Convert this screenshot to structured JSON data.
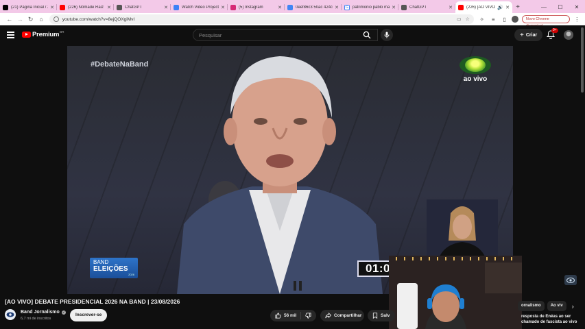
{
  "browser": {
    "tabs": [
      {
        "title": "(21) Página Inicial / X",
        "fav_color": "#000000"
      },
      {
        "title": "(226) Nômade Raiz -",
        "fav_color": "#ff0000"
      },
      {
        "title": "ChatGPT",
        "fav_color": "#555555"
      },
      {
        "title": "Watch Video Project -",
        "fav_color": "#3b82f6"
      },
      {
        "title": "(5) Instagram",
        "fav_color": "#d62976"
      },
      {
        "title": "0eef86c3 50ac 424c 8",
        "fav_color": "#4285f4"
      },
      {
        "title": "patrimonio pablo mar",
        "fav_color": "#4285f4"
      },
      {
        "title": "ChatGPT",
        "fav_color": "#555555"
      },
      {
        "title": "(226) [AO VIVO] D",
        "fav_color": "#ff0000",
        "active": true
      }
    ],
    "new_tab_label": "+",
    "url": "youtube.com/watch?v=8ejQOXgiMvI",
    "chrome_pill": "Novo Chrome disponível"
  },
  "youtube": {
    "logo_text": "Premium",
    "logo_country": "BR",
    "search_placeholder": "Pesquisar",
    "create_label": "Criar",
    "notif_count": "9+"
  },
  "video": {
    "hashtag": "#DebateNaBand",
    "live_label": "ao vivo",
    "eleicoes_line1": "BAND",
    "eleicoes_line2": "ELEIÇÕES",
    "eleicoes_year": "2026",
    "timer": "01:0",
    "title": "[AO VIVO] DEBATE PRESIDENCIAL 2026 NA BAND | 23/08/2026",
    "channel": "Band Jornalismo",
    "subscribers": "6,7 mi de inscritos",
    "subscribe_label": "Inscrever-se",
    "likes": "56 mil",
    "share_label": "Compartilhar",
    "save_label": "Salv"
  },
  "sidebar": {
    "chips": [
      "ornalismo",
      "Ao viv"
    ],
    "rec_text": "resposta de Enéas ao ser chamado de fascista ao vivo"
  },
  "colors": {
    "tabbar": "#f3c9e8",
    "yt_red": "#ff0000",
    "bg": "#0f0f0f"
  }
}
